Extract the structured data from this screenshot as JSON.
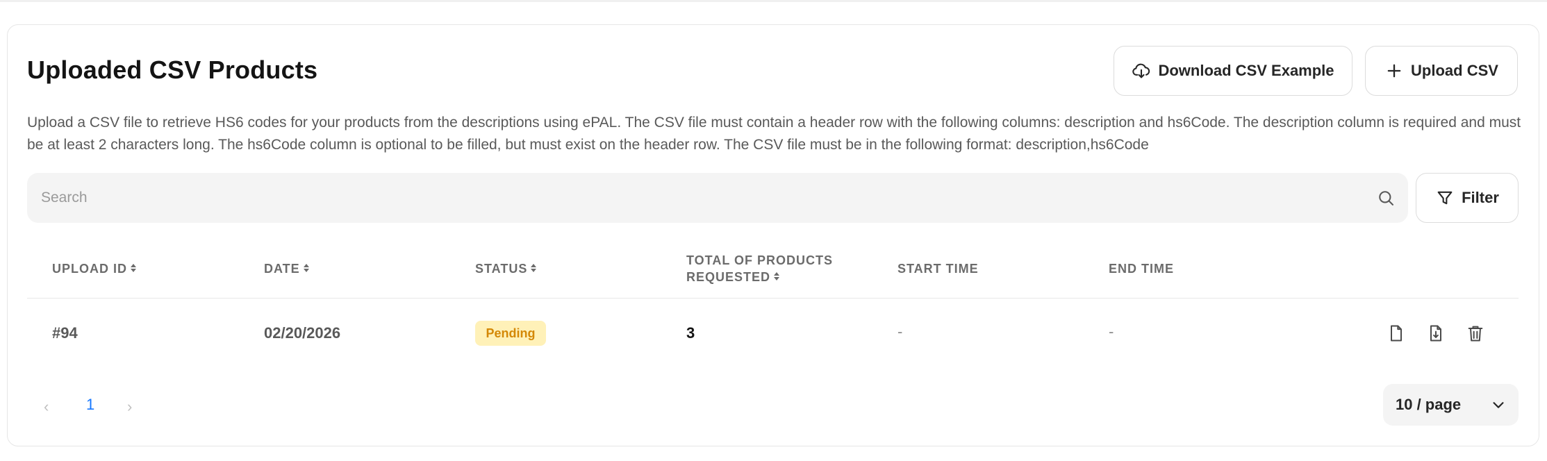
{
  "header": {
    "title": "Uploaded CSV Products",
    "download_label": "Download CSV Example",
    "upload_label": "Upload CSV"
  },
  "description": "Upload a CSV file to retrieve HS6 codes for your products from the descriptions using ePAL. The CSV file must contain a header row with the following columns: description and hs6Code. The description column is required and must be at least 2 characters long. The hs6Code column is optional to be filled, but must exist on the header row. The CSV file must be in the following format: description,hs6Code",
  "search": {
    "placeholder": "Search",
    "value": ""
  },
  "filter_label": "Filter",
  "table": {
    "columns": {
      "upload_id": "UPLOAD ID",
      "date": "DATE",
      "status": "STATUS",
      "total_line1": "TOTAL OF PRODUCTS",
      "total_line2": "REQUESTED",
      "start_time": "START TIME",
      "end_time": "END TIME"
    },
    "rows": [
      {
        "upload_id": "#94",
        "date": "02/20/2026",
        "status": "Pending",
        "total": "3",
        "start_time": "-",
        "end_time": "-",
        "actions": [
          "file-icon",
          "file-download-icon",
          "trash-icon"
        ]
      }
    ]
  },
  "pagination": {
    "prev": "‹",
    "next": "›",
    "current_page": "1",
    "page_size": "10 / page"
  },
  "colors": {
    "accent": "#1677ff",
    "pending_bg": "#fff1b8",
    "pending_text": "#d48806"
  }
}
